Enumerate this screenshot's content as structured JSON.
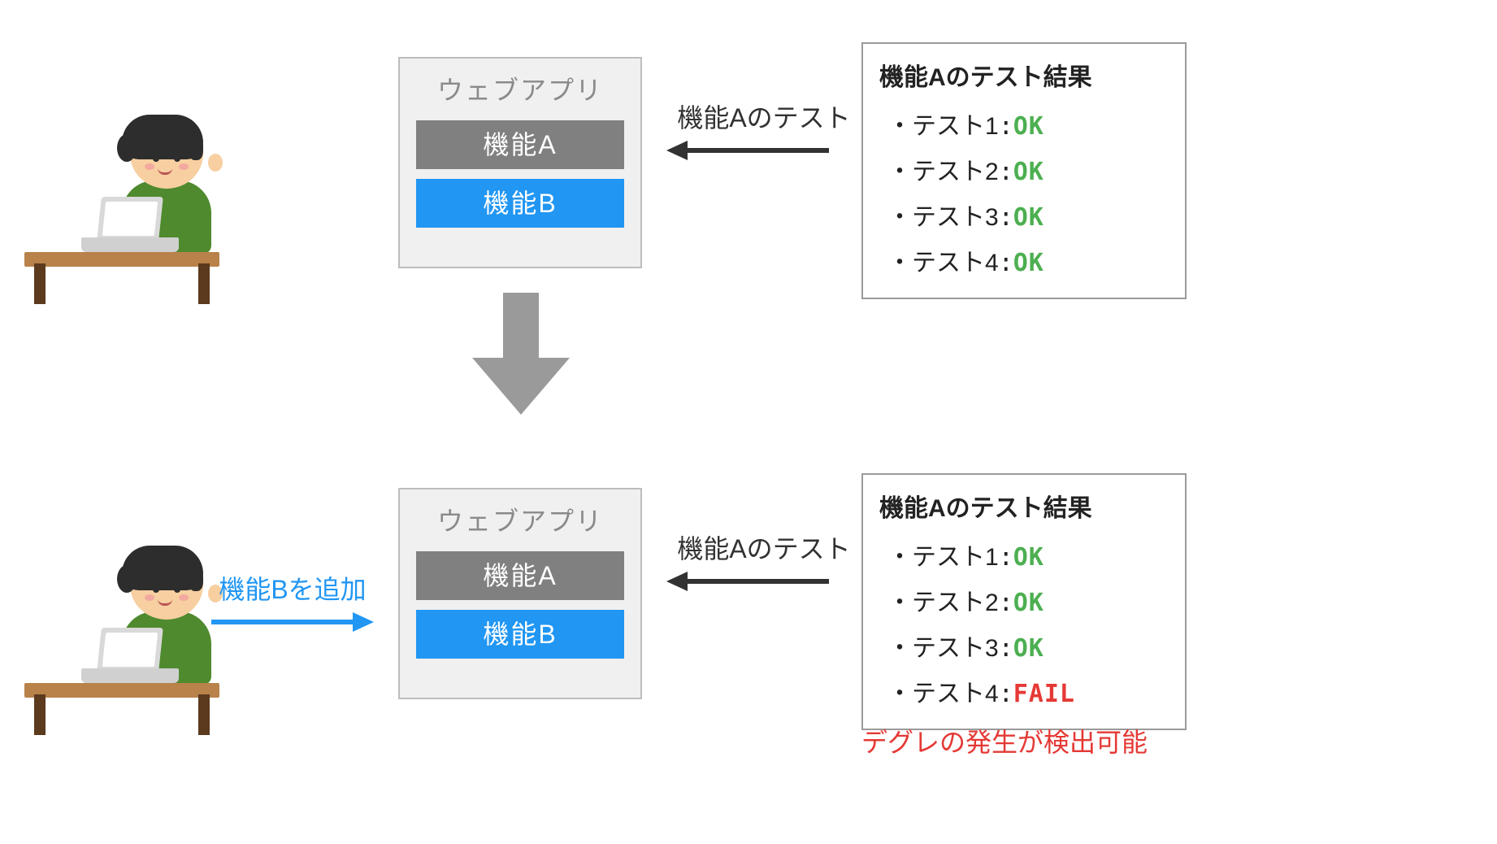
{
  "top": {
    "webapp_title": "ウェブアプリ",
    "feature_a": "機能A",
    "feature_b": "機能B",
    "test_arrow_label": "機能Aのテスト",
    "results_title": "機能Aのテスト結果",
    "results": [
      {
        "label": "テスト1",
        "status": "OK"
      },
      {
        "label": "テスト2",
        "status": "OK"
      },
      {
        "label": "テスト3",
        "status": "OK"
      },
      {
        "label": "テスト4",
        "status": "OK"
      }
    ]
  },
  "bottom": {
    "add_arrow_label": "機能Bを追加",
    "webapp_title": "ウェブアプリ",
    "feature_a": "機能A",
    "feature_b": "機能B",
    "test_arrow_label": "機能Aのテスト",
    "results_title": "機能Aのテスト結果",
    "results": [
      {
        "label": "テスト1",
        "status": "OK"
      },
      {
        "label": "テスト2",
        "status": "OK"
      },
      {
        "label": "テスト3",
        "status": "OK"
      },
      {
        "label": "テスト4",
        "status": "FAIL"
      }
    ],
    "footnote": "デグレの発生が検出可能"
  },
  "colors": {
    "ok": "#4CAF50",
    "fail": "#e53935",
    "accent_blue": "#2196f3",
    "gray": "#808080"
  }
}
